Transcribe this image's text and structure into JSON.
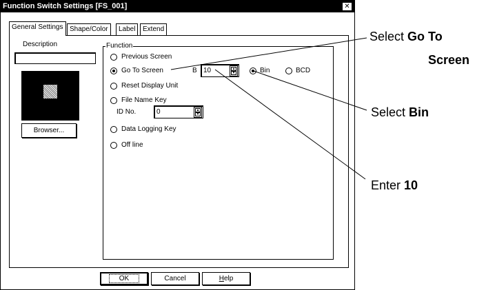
{
  "window": {
    "title": "Function Switch Settings [FS_001]",
    "close_glyph": "✕"
  },
  "tabs": [
    {
      "label": "General Settings",
      "active": true
    },
    {
      "label": "Shape/Color",
      "active": false
    },
    {
      "label": "Label",
      "active": false
    },
    {
      "label": "Extend",
      "active": false
    }
  ],
  "description": {
    "label": "Description",
    "value": ""
  },
  "browser_button": "Browser...",
  "function_group": {
    "title": "Function",
    "options": [
      {
        "label": "Previous Screen",
        "checked": false
      },
      {
        "label": "Go To Screen",
        "checked": true
      },
      {
        "label": "Reset Display Unit",
        "checked": false
      },
      {
        "label": "File Name Key",
        "checked": false
      },
      {
        "label": "Data Logging Key",
        "checked": false
      },
      {
        "label": "Off line",
        "checked": false
      }
    ],
    "goto_prefix": "B",
    "goto_value": "10",
    "format_options": [
      {
        "label": "Bin",
        "checked": true
      },
      {
        "label": "BCD",
        "checked": false
      }
    ],
    "id_label": "ID No.",
    "id_value": "0"
  },
  "buttons": {
    "ok": "OK",
    "cancel": "Cancel",
    "help_first": "H",
    "help_rest": "elp"
  },
  "callouts": {
    "goto_prefix": "Select ",
    "goto_bold_1": "Go To",
    "goto_bold_2": "Screen",
    "bin_prefix": "Select ",
    "bin_bold": "Bin",
    "enter_prefix": "Enter ",
    "enter_bold": "10"
  }
}
